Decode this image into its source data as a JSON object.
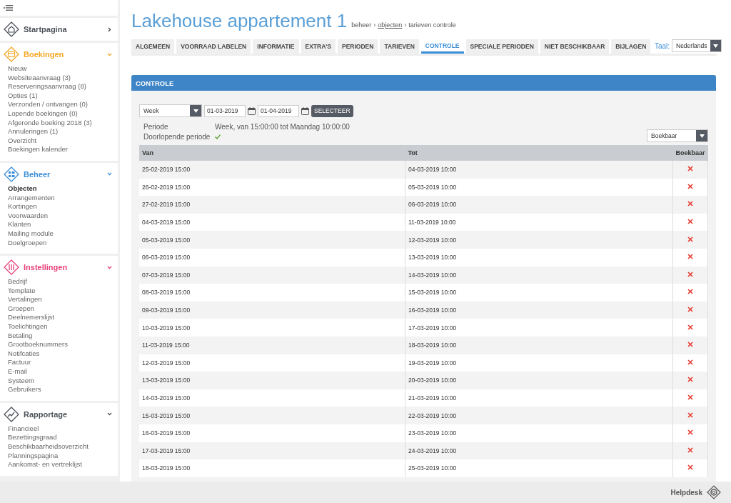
{
  "sidebar": {
    "sections": [
      {
        "title": "Startpagina",
        "kind": "home",
        "color": "#4a4f57",
        "expanded": false
      },
      {
        "title": "Boekingen",
        "kind": "bookings",
        "color": "#f5a623",
        "expanded": true,
        "items": [
          {
            "label": "Nieuw",
            "selected": false
          },
          {
            "label": "Websiteaanvraag (3)",
            "selected": false
          },
          {
            "label": "Reserveringsaanvraag (8)",
            "selected": false
          },
          {
            "label": "Opties (1)",
            "selected": false
          },
          {
            "label": "Verzonden / ontvangen (0)",
            "selected": false
          },
          {
            "label": "Lopende boekingen (0)",
            "selected": false
          },
          {
            "label": "Afgeronde boeking 2018 (3)",
            "selected": false
          },
          {
            "label": "Annuleringen (1)",
            "selected": false
          },
          {
            "label": "Overzicht",
            "selected": false
          },
          {
            "label": "Boekingen kalender",
            "selected": false
          }
        ]
      },
      {
        "title": "Beheer",
        "kind": "manage",
        "color": "#3a8ed8",
        "expanded": true,
        "items": [
          {
            "label": "Objecten",
            "selected": true
          },
          {
            "label": "Arrangementen",
            "selected": false
          },
          {
            "label": "Kortingen",
            "selected": false
          },
          {
            "label": "Voorwaarden",
            "selected": false
          },
          {
            "label": "Klanten",
            "selected": false
          },
          {
            "label": "Mailing module",
            "selected": false
          },
          {
            "label": "Doelgroepen",
            "selected": false
          }
        ]
      },
      {
        "title": "Instellingen",
        "kind": "settings",
        "color": "#e8407a",
        "expanded": true,
        "items": [
          {
            "label": "Bedrijf",
            "selected": false
          },
          {
            "label": "Template",
            "selected": false
          },
          {
            "label": "Vertalingen",
            "selected": false
          },
          {
            "label": "Groepen",
            "selected": false
          },
          {
            "label": "Deelnemerslijst",
            "selected": false
          },
          {
            "label": "Toelichtingen",
            "selected": false
          },
          {
            "label": "Betaling",
            "selected": false
          },
          {
            "label": "Grootboeknummers",
            "selected": false
          },
          {
            "label": "Notifcaties",
            "selected": false
          },
          {
            "label": "Factuur",
            "selected": false
          },
          {
            "label": "E-mail",
            "selected": false
          },
          {
            "label": "Systeem",
            "selected": false
          },
          {
            "label": "Gebruikers",
            "selected": false
          }
        ]
      },
      {
        "title": "Rapportage",
        "kind": "reports",
        "color": "#4a4f57",
        "expanded": true,
        "items": [
          {
            "label": "Financieel",
            "selected": false
          },
          {
            "label": "Bezettingsgraad",
            "selected": false
          },
          {
            "label": "Beschikbaarheidsoverzicht",
            "selected": false
          },
          {
            "label": "Planningspagina",
            "selected": false
          },
          {
            "label": "Aankomst- en vertreklijst",
            "selected": false
          }
        ]
      }
    ]
  },
  "header": {
    "title": "Lakehouse appartement 1",
    "breadcrumb": [
      {
        "kind": "text",
        "label": "beheer"
      },
      {
        "kind": "separator",
        "label": "›"
      },
      {
        "kind": "link",
        "label": "objecten"
      },
      {
        "kind": "separator",
        "label": "›"
      },
      {
        "kind": "text",
        "label": "tarieven controle"
      }
    ]
  },
  "tabs": [
    {
      "label": "ALGEMEEN",
      "selected": false
    },
    {
      "label": "VOORRAAD LABELEN",
      "selected": false
    },
    {
      "label": "INFORMATIE",
      "selected": false
    },
    {
      "label": "EXTRA'S",
      "selected": false
    },
    {
      "label": "PERIODEN",
      "selected": false
    },
    {
      "label": "TARIEVEN",
      "selected": false
    },
    {
      "label": "CONTROLE",
      "selected": true
    },
    {
      "label": "SPECIALE PERIODEN",
      "selected": false
    },
    {
      "label": "NIET BESCHIKBAAR",
      "selected": false
    },
    {
      "label": "BIJLAGEN",
      "selected": false
    }
  ],
  "language": {
    "label": "Taal:",
    "value": "Nederlands"
  },
  "panel": {
    "title": "CONTROLE",
    "period_select": "Week",
    "date_from": "01-03-2019",
    "date_to": "01-04-2019",
    "button": "SELECTEER",
    "info": [
      {
        "label": "Periode",
        "value": "Week, van 15:00:00 tot Maandag 10:00:00"
      },
      {
        "label": "Doorlopende periode",
        "checked": true
      }
    ],
    "filter_select": "Boekbaar",
    "table": {
      "columns": [
        "Van",
        "Tot",
        "Boekbaar"
      ],
      "rows": [
        {
          "van": "25-02-2019 15:00",
          "tot": "04-03-2019 10:00",
          "boekbaar": false
        },
        {
          "van": "26-02-2019 15:00",
          "tot": "05-03-2019 10:00",
          "boekbaar": false
        },
        {
          "van": "27-02-2019 15:00",
          "tot": "06-03-2019 10:00",
          "boekbaar": false
        },
        {
          "van": "04-03-2019 15:00",
          "tot": "11-03-2019 10:00",
          "boekbaar": false
        },
        {
          "van": "05-03-2019 15:00",
          "tot": "12-03-2019 10:00",
          "boekbaar": false
        },
        {
          "van": "06-03-2019 15:00",
          "tot": "13-03-2019 10:00",
          "boekbaar": false
        },
        {
          "van": "07-03-2019 15:00",
          "tot": "14-03-2019 10:00",
          "boekbaar": false
        },
        {
          "van": "08-03-2019 15:00",
          "tot": "15-03-2019 10:00",
          "boekbaar": false
        },
        {
          "van": "09-03-2019 15:00",
          "tot": "16-03-2019 10:00",
          "boekbaar": false
        },
        {
          "van": "10-03-2019 15:00",
          "tot": "17-03-2019 10:00",
          "boekbaar": false
        },
        {
          "van": "11-03-2019 15:00",
          "tot": "18-03-2019 10:00",
          "boekbaar": false
        },
        {
          "van": "12-03-2019 15:00",
          "tot": "19-03-2019 10:00",
          "boekbaar": false
        },
        {
          "van": "13-03-2019 15:00",
          "tot": "20-03-2019 10:00",
          "boekbaar": false
        },
        {
          "van": "14-03-2019 15:00",
          "tot": "21-03-2019 10:00",
          "boekbaar": false
        },
        {
          "van": "15-03-2019 15:00",
          "tot": "22-03-2019 10:00",
          "boekbaar": false
        },
        {
          "van": "16-03-2019 15:00",
          "tot": "23-03-2019 10:00",
          "boekbaar": false
        },
        {
          "van": "17-03-2019 15:00",
          "tot": "24-03-2019 10:00",
          "boekbaar": false
        },
        {
          "van": "18-03-2019 15:00",
          "tot": "25-03-2019 10:00",
          "boekbaar": false
        }
      ]
    }
  },
  "footer": {
    "helpdesk": "Helpdesk"
  }
}
